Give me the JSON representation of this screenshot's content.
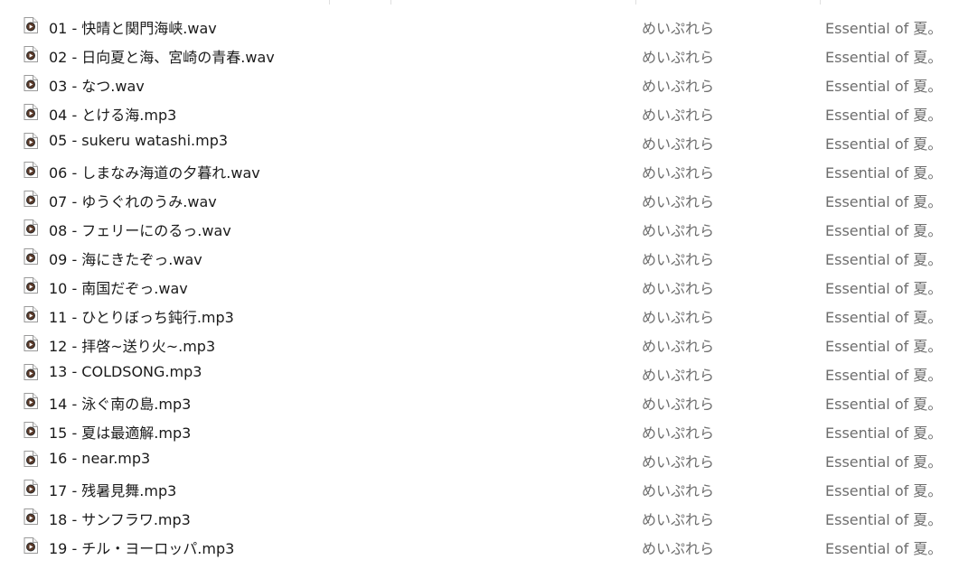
{
  "files": [
    {
      "name": "01 - 快晴と関門海峡.wav",
      "artist": "めいぷれら",
      "album": "Essential of 夏。"
    },
    {
      "name": "02 - 日向夏と海、宮崎の青春.wav",
      "artist": "めいぷれら",
      "album": "Essential of 夏。"
    },
    {
      "name": "03 - なつ.wav",
      "artist": "めいぷれら",
      "album": "Essential of 夏。"
    },
    {
      "name": "04 - とける海.mp3",
      "artist": "めいぷれら",
      "album": "Essential of 夏。"
    },
    {
      "name": "05 - sukeru watashi.mp3",
      "artist": "めいぷれら",
      "album": "Essential of 夏。"
    },
    {
      "name": "06 - しまなみ海道の夕暮れ.wav",
      "artist": "めいぷれら",
      "album": "Essential of 夏。"
    },
    {
      "name": "07 - ゆうぐれのうみ.wav",
      "artist": "めいぷれら",
      "album": "Essential of 夏。"
    },
    {
      "name": "08 - フェリーにのるっ.wav",
      "artist": "めいぷれら",
      "album": "Essential of 夏。"
    },
    {
      "name": "09 - 海にきたぞっ.wav",
      "artist": "めいぷれら",
      "album": "Essential of 夏。"
    },
    {
      "name": "10 - 南国だぞっ.wav",
      "artist": "めいぷれら",
      "album": "Essential of 夏。"
    },
    {
      "name": "11 - ひとりぼっち鈍行.mp3",
      "artist": "めいぷれら",
      "album": "Essential of 夏。"
    },
    {
      "name": "12 - 拝啓~送り火~.mp3",
      "artist": "めいぷれら",
      "album": "Essential of 夏。"
    },
    {
      "name": "13 - COLDSONG.mp3",
      "artist": "めいぷれら",
      "album": "Essential of 夏。"
    },
    {
      "name": "14 - 泳ぐ南の島.mp3",
      "artist": "めいぷれら",
      "album": "Essential of 夏。"
    },
    {
      "name": "15 - 夏は最適解.mp3",
      "artist": "めいぷれら",
      "album": "Essential of 夏。"
    },
    {
      "name": "16 - near.mp3",
      "artist": "めいぷれら",
      "album": "Essential of 夏。"
    },
    {
      "name": "17 - 残暑見舞.mp3",
      "artist": "めいぷれら",
      "album": "Essential of 夏。"
    },
    {
      "name": "18 - サンフラワ.mp3",
      "artist": "めいぷれら",
      "album": "Essential of 夏。"
    },
    {
      "name": "19 - チル・ヨーロッパ.mp3",
      "artist": "めいぷれら",
      "album": "Essential of 夏。"
    }
  ],
  "icon": "audio-file-icon"
}
